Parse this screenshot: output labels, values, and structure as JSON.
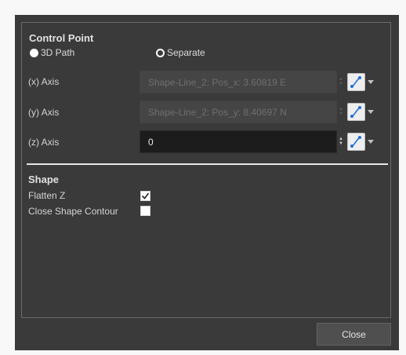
{
  "control_point": {
    "title": "Control Point",
    "radio_3d_path": "3D Path",
    "radio_separate": "Separate",
    "x_axis": {
      "label": "(x) Axis",
      "value": "Shape-Line_2: Pos_x: 3.60819 E"
    },
    "y_axis": {
      "label": "(y) Axis",
      "value": "Shape-Line_2: Pos_y: 8.40697 N"
    },
    "z_axis": {
      "label": "(z) Axis",
      "value": "0"
    }
  },
  "shape": {
    "title": "Shape",
    "flatten_z": {
      "label": "Flatten Z",
      "checked": true
    },
    "close_contour": {
      "label": "Close Shape Contour",
      "checked": false
    }
  },
  "footer": {
    "close_label": "Close"
  },
  "colors": {
    "dialog_bg": "#3a3a3a",
    "field_active_bg": "#1c1c1c",
    "function_icon": "#1f6fd6"
  },
  "icons": [
    "function-curve-icon",
    "dropdown-arrow-icon",
    "checkmark-icon"
  ]
}
